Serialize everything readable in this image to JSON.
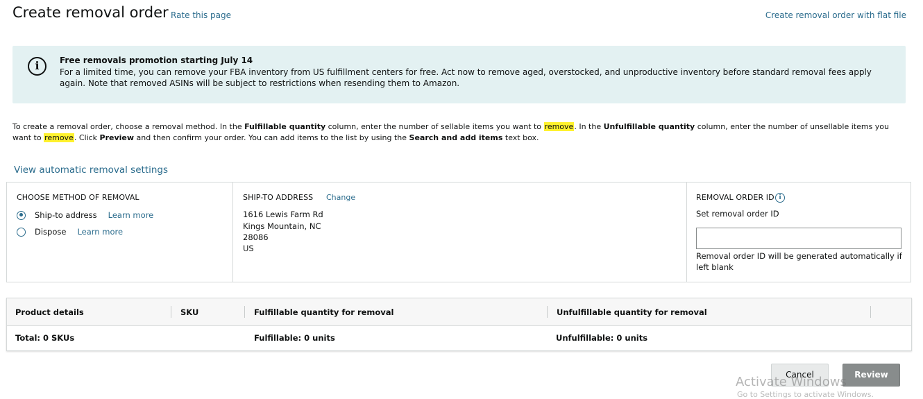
{
  "header": {
    "title": "Create removal order",
    "rate_link": "Rate this page",
    "flat_file_link": "Create removal order with flat file"
  },
  "promo": {
    "icon": "info-icon",
    "title": "Free removals promotion starting July 14",
    "body": "For a limited time, you can remove your FBA inventory from US fulfillment centers for free. Act now to remove aged, overstocked, and unproductive inventory before standard removal fees apply again. Note that removed ASINs will be subject to restrictions when resending them to Amazon."
  },
  "instructions": {
    "p1": "To create a removal order, choose a removal method. In the ",
    "b1": "Fulfillable quantity",
    "p2": " column, enter the number of sellable items you want to ",
    "hl1": "remove",
    "p3": ". In the ",
    "b2": "Unfulfillable quantity",
    "p4": " column, enter the number of unsellable items you want to ",
    "hl2": "remove",
    "p5": ". Click ",
    "b3": "Preview",
    "p6": " and then confirm your order. You can add items to the list by using the ",
    "b4": "Search and add items",
    "p7": " text box.",
    "highlight_color": "#fff22e"
  },
  "auto_settings_link": "View automatic removal settings",
  "method": {
    "heading": "CHOOSE METHOD OF REMOVAL",
    "options": [
      {
        "label": "Ship-to address",
        "link": "Learn more",
        "selected": true
      },
      {
        "label": "Dispose",
        "link": "Learn more",
        "selected": false
      }
    ]
  },
  "ship_to": {
    "heading": "SHIP-TO ADDRESS",
    "change_link": "Change",
    "lines": [
      "1616 Lewis Farm Rd",
      "Kings Mountain, NC",
      "28086",
      "US"
    ]
  },
  "order_id": {
    "heading": "REMOVAL ORDER ID",
    "info_icon": "info-icon",
    "label": "Set removal order ID",
    "value": "",
    "placeholder": "",
    "help": "Removal order ID will be generated automatically if left blank"
  },
  "table": {
    "columns": [
      "Product details",
      "SKU",
      "Fulfillable quantity for removal",
      "Unfulfillable quantity for removal"
    ],
    "totals": {
      "total": "Total: 0 SKUs",
      "fulfillable": "Fulfillable: 0 units",
      "unfulfillable": "Unfulfillable: 0 units"
    }
  },
  "buttons": {
    "cancel": "Cancel",
    "review": "Review"
  },
  "watermark": {
    "title": "Activate Windows",
    "subtitle": "Go to Settings to activate Windows."
  },
  "colors": {
    "link": "#2b6c8d",
    "promo_bg": "#e3f1f2",
    "review_button": "#888c8c"
  }
}
